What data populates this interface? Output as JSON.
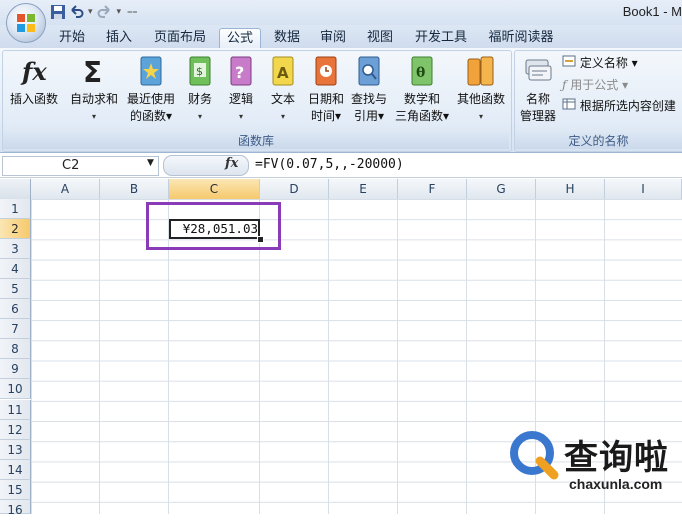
{
  "window": {
    "title": "Book1 - M"
  },
  "ribbon": {
    "tabs": [
      "开始",
      "插入",
      "页面布局",
      "公式",
      "数据",
      "审阅",
      "视图",
      "开发工具",
      "福昕阅读器"
    ],
    "active_tab": "公式",
    "function_library": {
      "group_label": "函数库",
      "buttons": [
        {
          "line1": "插入函数",
          "line2": ""
        },
        {
          "line1": "自动求和",
          "line2": "▾"
        },
        {
          "line1": "最近使用",
          "line2": "的函数▾"
        },
        {
          "line1": "财务",
          "line2": "▾"
        },
        {
          "line1": "逻辑",
          "line2": "▾"
        },
        {
          "line1": "文本",
          "line2": "▾"
        },
        {
          "line1": "日期和",
          "line2": "时间▾"
        },
        {
          "line1": "查找与",
          "line2": "引用▾"
        },
        {
          "line1": "数学和",
          "line2": "三角函数▾"
        },
        {
          "line1": "其他函数",
          "line2": "▾"
        }
      ]
    },
    "defined_names": {
      "group_label": "定义的名称",
      "name_manager_line1": "名称",
      "name_manager_line2": "管理器",
      "define_name": "定义名称 ▾",
      "use_in_formula": "用于公式 ▾",
      "create_from_selection": "根据所选内容创建"
    }
  },
  "formula_bar": {
    "name_box": "C2",
    "fx_label": "fx",
    "formula": "=FV(0.07,5,,-20000)"
  },
  "sheet": {
    "columns": [
      "A",
      "B",
      "C",
      "D",
      "E",
      "F",
      "G",
      "H",
      "I"
    ],
    "rows": [
      "1",
      "2",
      "3",
      "4",
      "5",
      "6",
      "7",
      "8",
      "9",
      "10",
      "11",
      "12",
      "13",
      "14",
      "15",
      "16"
    ],
    "selected_column": "C",
    "selected_row": "2",
    "active_cell": {
      "ref": "C2",
      "value": "¥28,051.03"
    }
  },
  "watermark": {
    "text": "查询啦",
    "url": "chaxunla.com"
  },
  "colors": {
    "highlight": "#8a3bb8",
    "selection_header": "#f6c96c",
    "accent": "#3a78d0"
  }
}
